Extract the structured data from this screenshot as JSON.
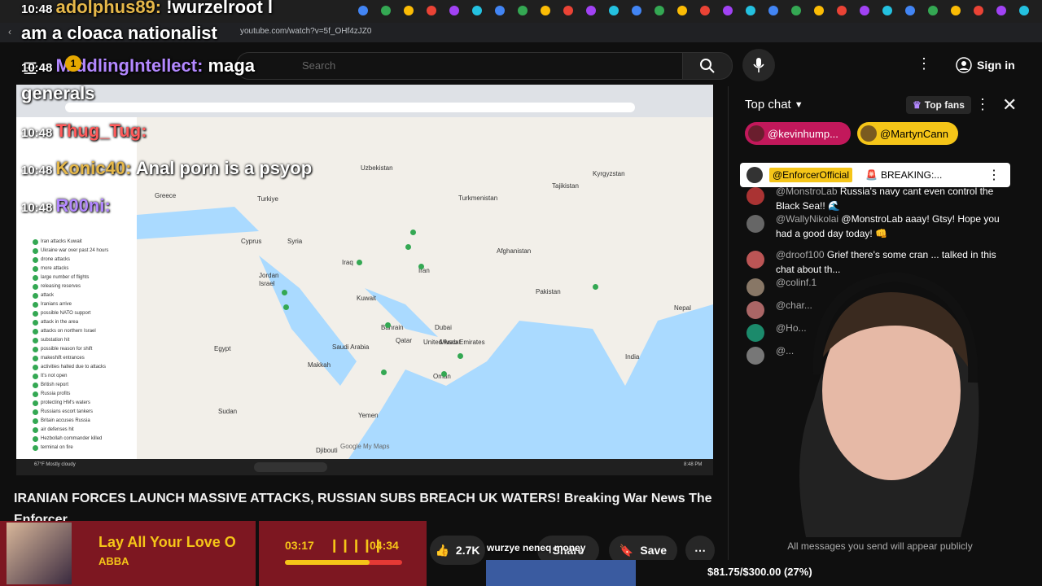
{
  "browser": {
    "url": "youtube.com/watch?v=5f_OHf4zJZ0"
  },
  "overlay_chat": [
    {
      "time": "10:48",
      "user": "adolphus89",
      "text": "!wurzelroot l",
      "user_color": "#e6b84a"
    },
    {
      "time": "",
      "user": "",
      "text": "am a cloaca nationalist",
      "user_color": "#ffffff"
    },
    {
      "time": "10:48",
      "user": "MiddlingIntellect",
      "text": "maga",
      "user_color": "#b388ff"
    },
    {
      "time": "",
      "user": "",
      "text": "generals",
      "user_color": "#ffffff"
    },
    {
      "time": "10:48",
      "user": "Thug_Tug",
      "text": "",
      "user_color": "#ff5a5a"
    },
    {
      "time": "10:48",
      "user": "Konic40",
      "text": "Anal porn is a psyop",
      "user_color": "#e6b84a"
    },
    {
      "time": "10:48",
      "user": "R00ni",
      "text": "",
      "user_color": "#b388ff"
    }
  ],
  "header": {
    "time": "10:48",
    "notification_count": "1",
    "search_placeholder": "Search",
    "signin_label": "Sign in"
  },
  "video": {
    "title": "IRANIAN FORCES LAUNCH MASSIVE ATTACKS, RUSSIAN SUBS BREACH UK WATERS! Breaking War News The Enforcer",
    "map_brand": "Google My Maps",
    "map_countries": [
      "Uzbekistan",
      "Kyrgyzstan",
      "Turkmenistan",
      "Tajikistan",
      "Greece",
      "Turkiye",
      "Cyprus",
      "Syria",
      "Iraq",
      "Iran",
      "Afghanistan",
      "Pakistan",
      "Nepal",
      "India",
      "Egypt",
      "Jordan",
      "Israel",
      "Kuwait",
      "Bahrain",
      "Qatar",
      "United Arab Emirates",
      "Saudi Arabia",
      "Oman",
      "Sudan",
      "Yemen",
      "Djibouti",
      "Muscat",
      "Makkah",
      "Dubai"
    ],
    "panel_items": [
      "Iran attacks Kuwait",
      "Ukraine war over past 24 hours",
      "drone attacks",
      "more attacks",
      "large number of flights",
      "releasing reserves",
      "attack",
      "Iranians arrive",
      "possible NATO support",
      "attack in the area",
      "attacks on northern Israel",
      "substation hit",
      "possible reason for shift",
      "makeshift entrances",
      "activities halted due to attacks",
      "It's not open",
      "British report",
      "Russia profits",
      "protecting HM's waters",
      "Russians escort tankers",
      "Britain accuses Russia",
      "air defenses hit",
      "Hezbollah commander killed",
      "terminal on fire"
    ],
    "taskbar_weather": "67°F Mostly cloudy",
    "taskbar_time": "8:48 PM"
  },
  "chat": {
    "header": "Top chat",
    "top_fans_label": "Top fans",
    "pinned_users": [
      "@kevinhump...",
      "@MartynCann"
    ],
    "pinned_message": {
      "user": "@EnforcerOfficial",
      "text": "BREAKING:..."
    },
    "messages": [
      {
        "author": "@MonstroLab",
        "text": "Russia's navy cant even control the Black Sea!! 🌊",
        "avatar_color": "#a33"
      },
      {
        "author": "@WallyNikolai",
        "text": "@MonstroLab aaay! Gtsy! Hope you had a good day today! 👊",
        "avatar_color": "#666"
      },
      {
        "author": "@droof100",
        "text": "Grief there's some cran ... talked in this chat about th...",
        "avatar_color": "#b55"
      },
      {
        "author": "@colinf.1",
        "text": "",
        "avatar_color": "#876"
      },
      {
        "author": "@char...",
        "text": "",
        "avatar_color": "#a66"
      },
      {
        "author": "@Ho...",
        "text": "",
        "avatar_color": "#1b8a6b"
      },
      {
        "author": "@...",
        "text": "",
        "avatar_color": "#777"
      }
    ],
    "footer": "All messages you send will appear publicly"
  },
  "now_playing": {
    "song": "Lay All Your Love O",
    "artist": "ABBA",
    "elapsed": "03:17",
    "total": "04:34",
    "progress": 0.72
  },
  "actions": {
    "like_count": "2.7K",
    "share_label": "Share",
    "save_label": "Save",
    "ticker_text": "wurzye neneq money"
  },
  "goal": {
    "text": "$81.75/$300.00 (27%)",
    "fraction": 0.27
  },
  "colors": {
    "accent_red": "#7d1721",
    "progress_yellow": "#f5c518",
    "pill_pink": "#c2185b",
    "pill_gold": "#f5c518",
    "goal_blue": "#3a5ba0"
  }
}
